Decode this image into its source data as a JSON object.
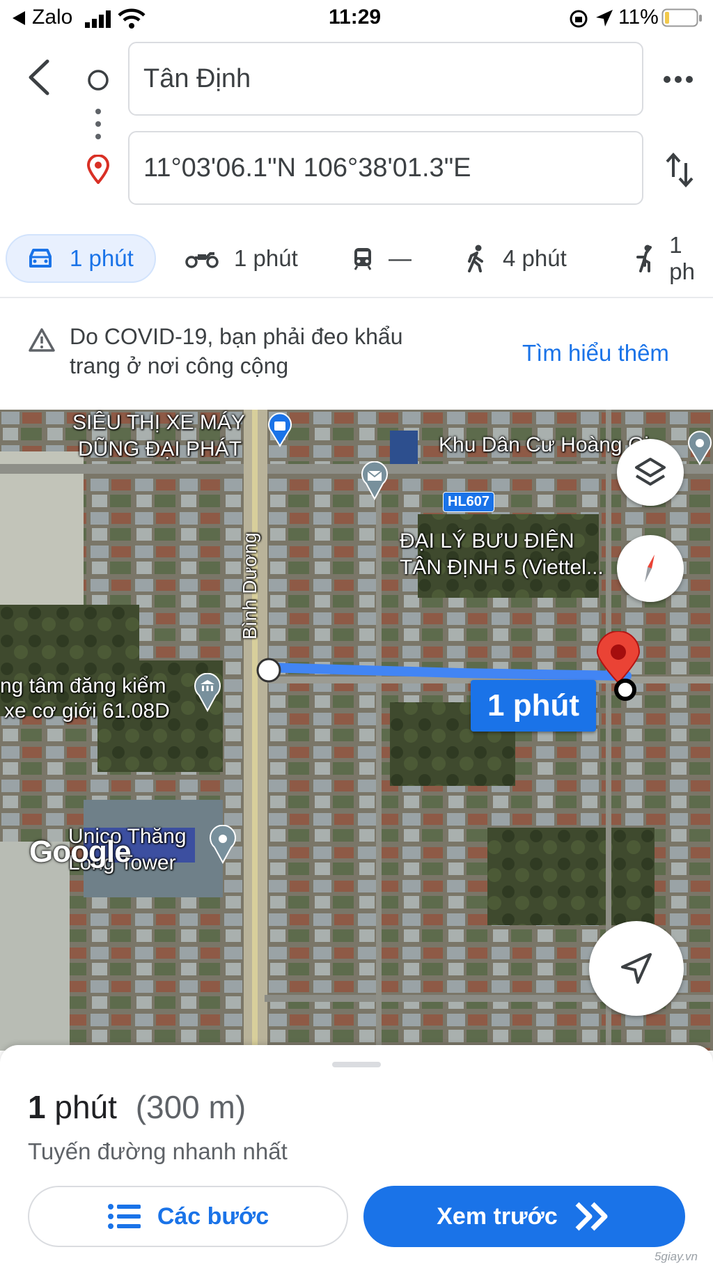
{
  "status_bar": {
    "back_app": "Zalo",
    "time": "11:29",
    "battery": "11%"
  },
  "search": {
    "origin": "Tân Định",
    "destination": "11°03'06.1\"N 106°38'01.3\"E"
  },
  "modes": [
    {
      "label": "1 phút",
      "icon": "car-icon",
      "active": true
    },
    {
      "label": "1 phút",
      "icon": "motorcycle-icon"
    },
    {
      "label": "—",
      "icon": "transit-icon"
    },
    {
      "label": "4 phút",
      "icon": "walk-icon"
    },
    {
      "label": "1 ph",
      "icon": "rideshare-icon"
    }
  ],
  "notice": {
    "text": "Do COVID-19, bạn phải đeo khẩu trang ở nơi công cộng",
    "link": "Tìm hiểu thêm"
  },
  "map": {
    "poi_1_line1": "SIÊU THỊ XE MÁY",
    "poi_1_line2": "DŨNG ĐẠI PHÁT",
    "poi_2": "Khu Dân Cư Hoàng Gia",
    "road_badge": "HL607",
    "poi_3_line1": "ĐẠI LÝ BƯU ĐIỆN",
    "poi_3_line2": "TÂN ĐỊNH 5 (Viettel...",
    "road_name": "Bình Dương",
    "poi_4_line1": "ng tâm đăng kiểm",
    "poi_4_line2": "xe cơ giới 61.08D",
    "route_time": "1 phút",
    "poi_5_line1": "Unico Thăng",
    "poi_5_line2": "Long Tower",
    "logo": "Google",
    "route_color": "#4285f4"
  },
  "summary": {
    "time_num": "1",
    "time_unit": "phút",
    "distance": "(300 m)",
    "subtitle": "Tuyến đường nhanh nhất"
  },
  "buttons": {
    "steps": "Các bước",
    "preview": "Xem trước"
  },
  "watermark": "5giay.vn"
}
